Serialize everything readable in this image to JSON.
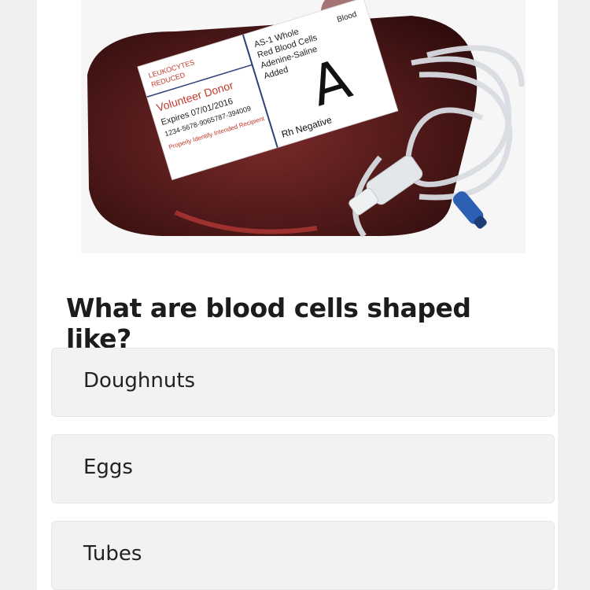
{
  "question": "What are blood cells shaped like?",
  "options": [
    "Doughnuts",
    "Eggs",
    "Tubes"
  ],
  "image": {
    "alt": "Blood bag with label",
    "label": {
      "type_letter": "A",
      "rh": "Rh Negative",
      "line1": "AS-1 Whole",
      "line2": "Red Blood Cells",
      "line3": "Adenine-Saline",
      "line4": "Added",
      "leuko1": "LEUKOCYTES",
      "leuko2": "REDUCED",
      "donor": "Volunteer Donor",
      "expires": "Expires 07/01/2016",
      "code": "1234-5678-9065787-394009",
      "warning": "Properly Identify Intended Recipient",
      "blood": "Blood"
    }
  },
  "colors": {
    "background": "#efeff1",
    "card": "#ffffff",
    "option_bg": "#f2f2f3",
    "blood": "#5a1e1e"
  }
}
